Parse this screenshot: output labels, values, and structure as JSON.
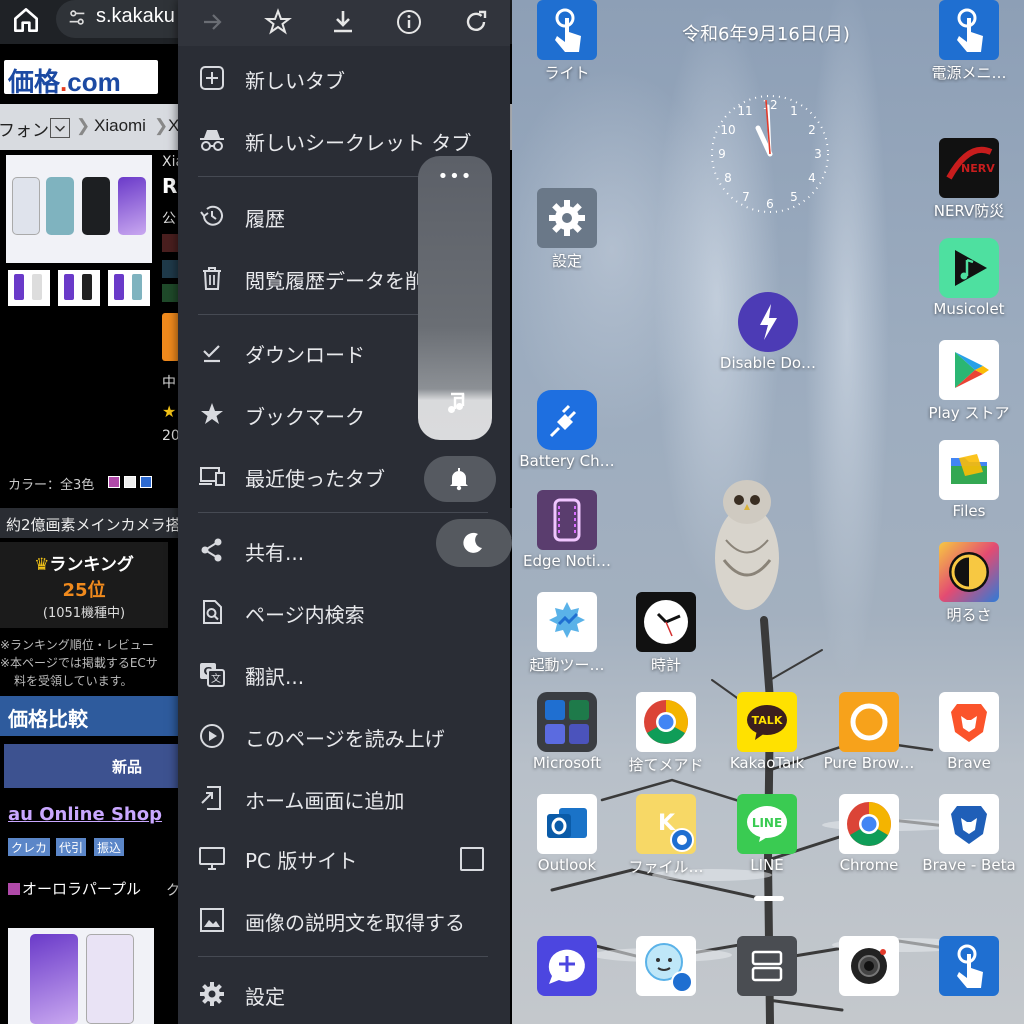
{
  "browser": {
    "url": "s.kakaku",
    "logo": {
      "prefix": "価格",
      "dot": ".",
      "suffix": "com"
    },
    "breadcrumb": [
      "フォン",
      "Xiaomi",
      "X"
    ],
    "product": {
      "maker_partial": "Xia",
      "name_partial": "R",
      "text1": "公",
      "text2": "中",
      "text3": "20"
    },
    "colors_label": "カラー：全3色",
    "headline": "約2億画素メインカメラ搭",
    "ranking": {
      "title": "ランキング",
      "value": "25位",
      "sub": "(1051機種中)"
    },
    "notes": [
      "※ランキング順位・レビュー",
      "※本ページでは掲載するECサ",
      "料を受領しています。"
    ],
    "price_compare": "価格比較",
    "new_tab": "新品",
    "shop": "au Online Shop",
    "tags": [
      "クレカ",
      "代引",
      "振込"
    ],
    "color_name": "オーロラパープル",
    "color_name_right": "ク"
  },
  "menu": {
    "items": [
      {
        "label": "新しいタブ",
        "icon": "new-tab-icon"
      },
      {
        "label": "新しいシークレット タブ",
        "icon": "incognito-icon"
      },
      {
        "label": "履歴",
        "icon": "history-icon"
      },
      {
        "label": "閲覧履歴データを削",
        "icon": "trash-icon"
      },
      {
        "label": "ダウンロード",
        "icon": "downloads-icon"
      },
      {
        "label": "ブックマーク",
        "icon": "bookmark-star-icon"
      },
      {
        "label": "最近使ったタブ",
        "icon": "recent-tabs-icon"
      },
      {
        "label": "共有...",
        "icon": "share-icon"
      },
      {
        "label": "ページ内検索",
        "icon": "find-in-page-icon"
      },
      {
        "label": "翻訳...",
        "icon": "translate-icon"
      },
      {
        "label": "このページを読み上げ",
        "icon": "read-aloud-icon"
      },
      {
        "label": "ホーム画面に追加",
        "icon": "add-to-home-icon"
      },
      {
        "label": "PC 版サイト",
        "icon": "desktop-site-icon",
        "checked": false
      },
      {
        "label": "画像の説明文を取得する",
        "icon": "image-description-icon"
      },
      {
        "label": "設定",
        "icon": "settings-gear-icon"
      }
    ]
  },
  "panel": {
    "dots": "•••"
  },
  "home": {
    "date": "令和6年9月16日(月)",
    "apps": [
      {
        "name": "ライト",
        "icon": "touch-hand-icon",
        "bg": "#1f6fd1"
      },
      {
        "name": "電源メニ…",
        "icon": "touch-hand-icon",
        "bg": "#1f6fd1"
      },
      {
        "name": "設定",
        "icon": "settings-gear-icon",
        "bg": "#6a7888"
      },
      {
        "name": "NERV防災",
        "icon": "nerv-icon",
        "bg": "#111111"
      },
      {
        "name": "Disable Do…",
        "icon": "lightning-icon",
        "bg": "#4c3bb5"
      },
      {
        "name": "Musicolet",
        "icon": "music-play-icon",
        "bg": "#4ee0a0"
      },
      {
        "name": "Play ストア",
        "icon": "play-store-icon",
        "bg": "#ffffff"
      },
      {
        "name": "Battery Ch…",
        "icon": "plug-icon",
        "bg": "#1e6fe0"
      },
      {
        "name": "Files",
        "icon": "files-folder-icon",
        "bg": "#ffffff"
      },
      {
        "name": "Edge Noti…",
        "icon": "edge-notification-icon",
        "bg": "#5a3d6e"
      },
      {
        "name": "明るさ",
        "icon": "brightness-icon",
        "bg": "#e34b72"
      },
      {
        "name": "起動ツー…",
        "icon": "launcher-icon",
        "bg": "#ffffff"
      },
      {
        "name": "時計",
        "icon": "clock-app-icon",
        "bg": "#111111"
      },
      {
        "name": "Microsoft",
        "icon": "microsoft-folder-icon",
        "bg": "#3a3d42"
      },
      {
        "name": "捨てメアド",
        "icon": "chrome-icon",
        "bg": "#ffffff"
      },
      {
        "name": "KakaoTalk",
        "icon": "kakaotalk-icon",
        "bg": "#ffe100"
      },
      {
        "name": "Pure Brow…",
        "icon": "pure-browser-icon",
        "bg": "#f7a21b"
      },
      {
        "name": "Brave",
        "icon": "brave-icon",
        "bg": "#ffffff"
      },
      {
        "name": "Outlook",
        "icon": "outlook-icon",
        "bg": "#ffffff"
      },
      {
        "name": "ファイル…",
        "icon": "file-k-icon",
        "bg": "#f7d866"
      },
      {
        "name": "LINE",
        "icon": "line-icon",
        "bg": "#3acb52"
      },
      {
        "name": "Chrome",
        "icon": "chrome-icon",
        "bg": "#ffffff"
      },
      {
        "name": "Brave - Beta",
        "icon": "brave-beta-icon",
        "bg": "#ffffff"
      },
      {
        "name": "",
        "icon": "messages-icon",
        "bg": "#4c46e0"
      },
      {
        "name": "",
        "icon": "imei-face-icon",
        "bg": "#ffffff"
      },
      {
        "name": "",
        "icon": "multiwindow-icon",
        "bg": "#4a4d52"
      },
      {
        "name": "",
        "icon": "camera-icon",
        "bg": "#ffffff"
      },
      {
        "name": "",
        "icon": "touch-hand-icon",
        "bg": "#1f6fd1"
      }
    ]
  }
}
